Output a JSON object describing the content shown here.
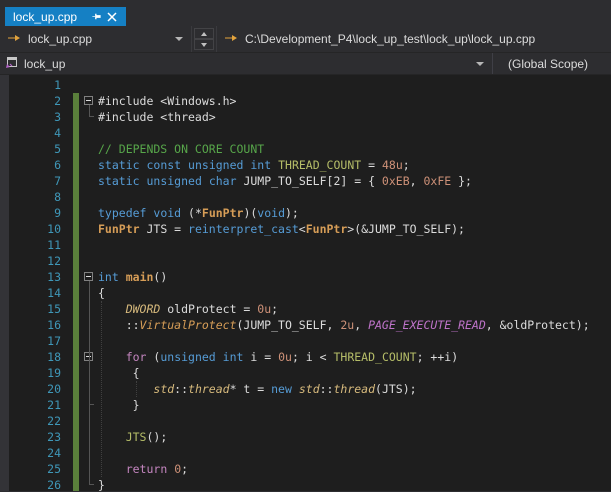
{
  "tab": {
    "title": "lock_up.cpp"
  },
  "navbar": {
    "file_dropdown": "lock_up.cpp",
    "path_dropdown": "C:\\Development_P4\\lock_up_test\\lock_up\\lock_up.cpp",
    "project_dropdown": "lock_up",
    "scope_dropdown": "(Global Scope)"
  },
  "icons": {
    "pin": "pin-icon",
    "close": "close-icon",
    "goto_arrow": "goto-arrow-icon",
    "project": "cpp-project-icon",
    "chevron": "chevron-down-icon"
  },
  "colors": {
    "tab_active": "#1580c4",
    "chrome_bg": "#2d2d30",
    "editor_bg": "#1e1e1e",
    "line_number": "#3f97b8",
    "change_bar_green": "#5a7f3b",
    "keyword": "#569cd6",
    "control_keyword": "#c586c0",
    "comment": "#57a64a",
    "number": "#ce9178",
    "constant": "#b5bd68",
    "type_italic": "#d7ba7d",
    "function_orange": "#d69d57",
    "macro_purple": "#be73c9"
  },
  "editor": {
    "lines": [
      {
        "n": 1,
        "tokens": []
      },
      {
        "n": 2,
        "fold": true,
        "tokens": [
          [
            "pl",
            "#include <Windows.h>"
          ]
        ]
      },
      {
        "n": 3,
        "tokens": [
          [
            "pl",
            "#include <thread>"
          ]
        ]
      },
      {
        "n": 4,
        "tokens": []
      },
      {
        "n": 5,
        "tokens": [
          [
            "cm",
            "// DEPENDS ON CORE COUNT"
          ]
        ]
      },
      {
        "n": 6,
        "tokens": [
          [
            "kw",
            "static"
          ],
          [
            "pl",
            " "
          ],
          [
            "kw",
            "const"
          ],
          [
            "pl",
            " "
          ],
          [
            "kw",
            "unsigned"
          ],
          [
            "pl",
            " "
          ],
          [
            "kw",
            "int"
          ],
          [
            "pl",
            " "
          ],
          [
            "const",
            "THREAD_COUNT"
          ],
          [
            "pl",
            " = "
          ],
          [
            "num",
            "48u"
          ],
          [
            "pl",
            ";"
          ]
        ]
      },
      {
        "n": 7,
        "tokens": [
          [
            "kw",
            "static"
          ],
          [
            "pl",
            " "
          ],
          [
            "kw",
            "unsigned"
          ],
          [
            "pl",
            " "
          ],
          [
            "kw",
            "char"
          ],
          [
            "pl",
            " JUMP_TO_SELF[2] = { "
          ],
          [
            "num",
            "0xEB"
          ],
          [
            "pl",
            ", "
          ],
          [
            "num",
            "0xFE"
          ],
          [
            "pl",
            " };"
          ]
        ]
      },
      {
        "n": 8,
        "tokens": []
      },
      {
        "n": 9,
        "tokens": [
          [
            "kw",
            "typedef"
          ],
          [
            "pl",
            " "
          ],
          [
            "kw",
            "void"
          ],
          [
            "pl",
            " (*"
          ],
          [
            "fnb",
            "FunPtr"
          ],
          [
            "pl",
            ")("
          ],
          [
            "kw",
            "void"
          ],
          [
            "pl",
            ");"
          ]
        ]
      },
      {
        "n": 10,
        "tokens": [
          [
            "fnb",
            "FunPtr"
          ],
          [
            "pl",
            " JTS = "
          ],
          [
            "kw",
            "reinterpret_cast"
          ],
          [
            "pl",
            "<"
          ],
          [
            "fnb",
            "FunPtr"
          ],
          [
            "pl",
            ">(&JUMP_TO_SELF);"
          ]
        ]
      },
      {
        "n": 11,
        "tokens": []
      },
      {
        "n": 12,
        "tokens": []
      },
      {
        "n": 13,
        "fold": true,
        "tokens": [
          [
            "kw",
            "int"
          ],
          [
            "pl",
            " "
          ],
          [
            "fnb",
            "main"
          ],
          [
            "pl",
            "()"
          ]
        ]
      },
      {
        "n": 14,
        "tokens": [
          [
            "pl",
            "{"
          ]
        ]
      },
      {
        "n": 15,
        "tokens": [
          [
            "pl",
            "    "
          ],
          [
            "type",
            "DWORD"
          ],
          [
            "pl",
            " oldProtect = "
          ],
          [
            "num",
            "0u"
          ],
          [
            "pl",
            ";"
          ]
        ]
      },
      {
        "n": 16,
        "tokens": [
          [
            "pl",
            "    ::"
          ],
          [
            "fni",
            "VirtualProtect"
          ],
          [
            "pl",
            "(JUMP_TO_SELF, "
          ],
          [
            "num",
            "2u"
          ],
          [
            "pl",
            ", "
          ],
          [
            "macro",
            "PAGE_EXECUTE_READ"
          ],
          [
            "pl",
            ", &oldProtect);"
          ]
        ]
      },
      {
        "n": 17,
        "tokens": []
      },
      {
        "n": 18,
        "fold": true,
        "tokens": [
          [
            "pl",
            "    "
          ],
          [
            "ctrl",
            "for"
          ],
          [
            "pl",
            " ("
          ],
          [
            "kw",
            "unsigned"
          ],
          [
            "pl",
            " "
          ],
          [
            "kw",
            "int"
          ],
          [
            "pl",
            " i = "
          ],
          [
            "num",
            "0u"
          ],
          [
            "pl",
            "; i < "
          ],
          [
            "const",
            "THREAD_COUNT"
          ],
          [
            "pl",
            "; ++i)"
          ]
        ]
      },
      {
        "n": 19,
        "tokens": [
          [
            "pl",
            "     {"
          ]
        ]
      },
      {
        "n": 20,
        "tokens": [
          [
            "pl",
            "        "
          ],
          [
            "type",
            "std"
          ],
          [
            "pl",
            "::"
          ],
          [
            "type",
            "thread"
          ],
          [
            "pl",
            "* t = "
          ],
          [
            "kw",
            "new"
          ],
          [
            "pl",
            " "
          ],
          [
            "type",
            "std"
          ],
          [
            "pl",
            "::"
          ],
          [
            "type",
            "thread"
          ],
          [
            "pl",
            "(JTS);"
          ]
        ]
      },
      {
        "n": 21,
        "tokens": [
          [
            "pl",
            "     }"
          ]
        ]
      },
      {
        "n": 22,
        "tokens": []
      },
      {
        "n": 23,
        "tokens": [
          [
            "pl",
            "    "
          ],
          [
            "const",
            "JTS"
          ],
          [
            "pl",
            "();"
          ]
        ]
      },
      {
        "n": 24,
        "tokens": []
      },
      {
        "n": 25,
        "tokens": [
          [
            "pl",
            "    "
          ],
          [
            "ctrl",
            "return"
          ],
          [
            "pl",
            " "
          ],
          [
            "num",
            "0"
          ],
          [
            "pl",
            ";"
          ]
        ]
      },
      {
        "n": 26,
        "tokens": [
          [
            "pl",
            "}"
          ]
        ]
      }
    ]
  }
}
